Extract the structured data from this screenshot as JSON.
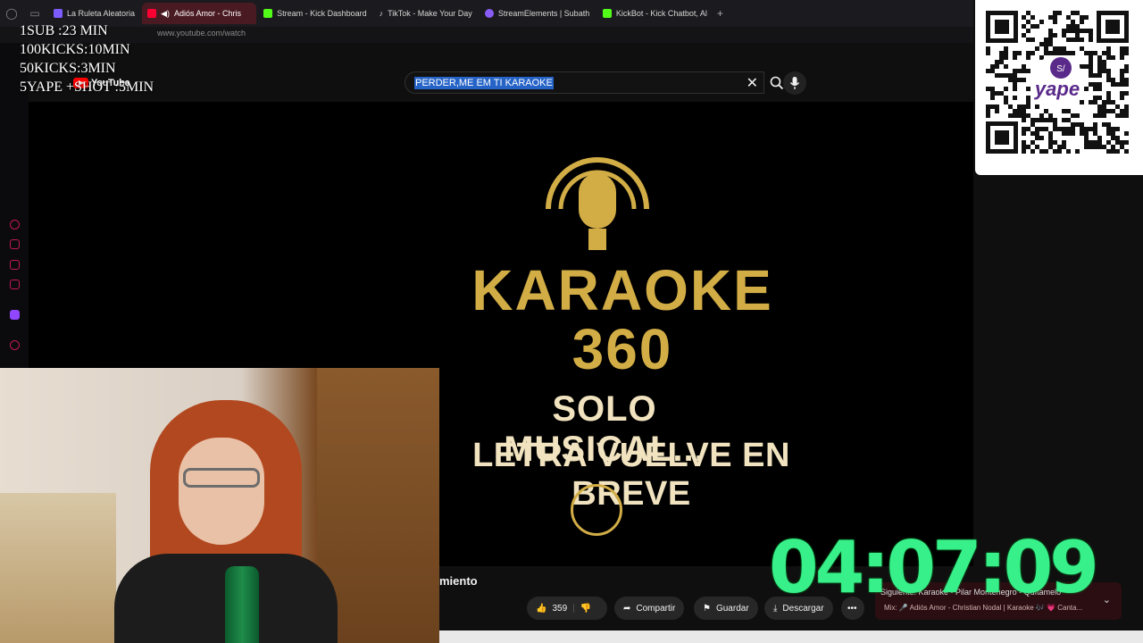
{
  "browser": {
    "tabs": [
      {
        "label": "La Ruleta Aleatoria",
        "color": "#7c5cff"
      },
      {
        "label": "Adiós Amor - Chris",
        "color": "#ff0033",
        "active": true
      },
      {
        "label": "Stream - Kick Dashboard",
        "color": "#53fc18"
      },
      {
        "label": "TikTok - Make Your Day",
        "color": "#111111"
      },
      {
        "label": "StreamElements | Subath",
        "color": "#8a5cf6"
      },
      {
        "label": "KickBot - Kick Chatbot, Al",
        "color": "#53fc18"
      }
    ],
    "url": "www.youtube.com/watch"
  },
  "youtube": {
    "logo": "YouTube",
    "search_value": "PERDER,ME EM TI KARAOKE",
    "video": {
      "brand_line1": "KARAOKE",
      "brand_line2": "360",
      "message_line1": "SOLO MUSICAL...",
      "message_line2": "LETRA VUELVE EN BREVE"
    },
    "title_fragment": "miento",
    "actions": {
      "likes": "359",
      "share": "Compartir",
      "save": "Guardar",
      "download": "Descargar"
    },
    "up_next": {
      "line1": "Siguiente: Karaoke - Pilar Montenegro - Quítamelo",
      "line2": "Mix: 🎤 Adiós Amor - Christian Nodal | Karaoke 🎶 💗 Canta..."
    }
  },
  "overlay": {
    "goals": [
      "1SUB :23 MIN",
      "100KICKS:10MIN",
      "50KICKS:3MIN",
      "5YAPE +SHOT :5MIN"
    ],
    "timer": "04:07:09",
    "qr_brand": "yape"
  }
}
